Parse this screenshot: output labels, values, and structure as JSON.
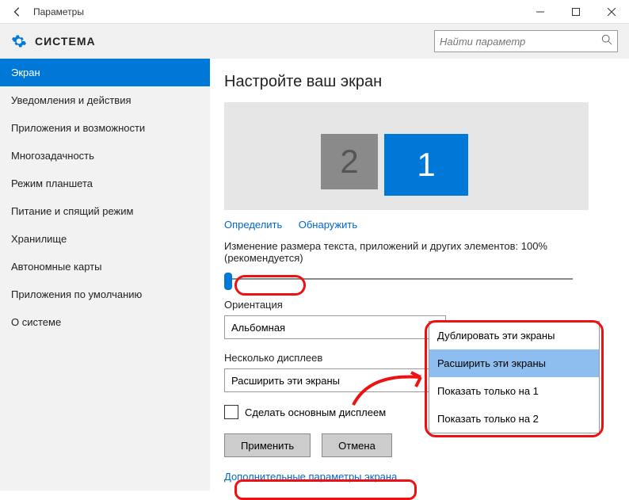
{
  "window": {
    "title": "Параметры"
  },
  "header": {
    "section": "СИСТЕМА",
    "search_placeholder": "Найти параметр"
  },
  "sidebar": {
    "items": [
      {
        "label": "Экран",
        "active": true
      },
      {
        "label": "Уведомления и действия"
      },
      {
        "label": "Приложения и возможности"
      },
      {
        "label": "Многозадачность"
      },
      {
        "label": "Режим планшета"
      },
      {
        "label": "Питание и спящий режим"
      },
      {
        "label": "Хранилище"
      },
      {
        "label": "Автономные карты"
      },
      {
        "label": "Приложения по умолчанию"
      },
      {
        "label": "О системе"
      }
    ]
  },
  "content": {
    "heading": "Настройте ваш экран",
    "display2_num": "2",
    "display1_num": "1",
    "identify_link": "Определить",
    "detect_link": "Обнаружить",
    "scale_label": "Изменение размера текста, приложений и других элементов: 100% (рекомендуется)",
    "orientation_label": "Ориентация",
    "orientation_value": "Альбомная",
    "multi_label": "Несколько дисплеев",
    "multi_value": "Расширить эти экраны",
    "make_primary": "Сделать основным дисплеем",
    "apply": "Применить",
    "cancel": "Отмена",
    "advanced": "Дополнительные параметры экрана"
  },
  "dropdown": {
    "options": [
      "Дублировать эти экраны",
      "Расширить эти экраны",
      "Показать только на 1",
      "Показать только на 2"
    ],
    "selected_index": 1
  }
}
